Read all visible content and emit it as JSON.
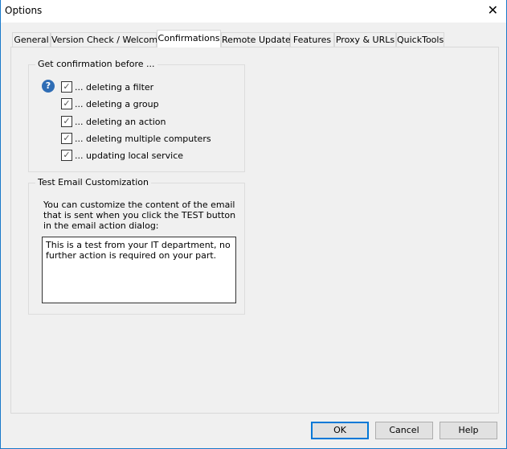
{
  "window": {
    "title": "Options",
    "close_icon": "close-icon"
  },
  "tabs": [
    {
      "label": "General"
    },
    {
      "label": "Version Check / Welcome"
    },
    {
      "label": "Confirmations",
      "selected": true
    },
    {
      "label": "Remote Update"
    },
    {
      "label": "Features"
    },
    {
      "label": "Proxy & URLs"
    },
    {
      "label": "QuickTools"
    }
  ],
  "confirm_group": {
    "label": "Get confirmation before ...",
    "help_icon": "?",
    "items": [
      {
        "label": "... deleting a filter",
        "checked": true
      },
      {
        "label": "... deleting a group",
        "checked": true
      },
      {
        "label": "... deleting an action",
        "checked": true
      },
      {
        "label": "... deleting multiple computers",
        "checked": true
      },
      {
        "label": "... updating local service",
        "checked": true
      }
    ]
  },
  "email_group": {
    "label": "Test Email Customization",
    "description": "You can customize the content of the email that is sent when you click the TEST button in the email action dialog:",
    "text": "This is a test from your IT department, no further action is required on your part."
  },
  "buttons": {
    "ok": "OK",
    "cancel": "Cancel",
    "help": "Help"
  },
  "colors": {
    "accent": "#0078d7",
    "help_icon": "#2f6db5"
  }
}
